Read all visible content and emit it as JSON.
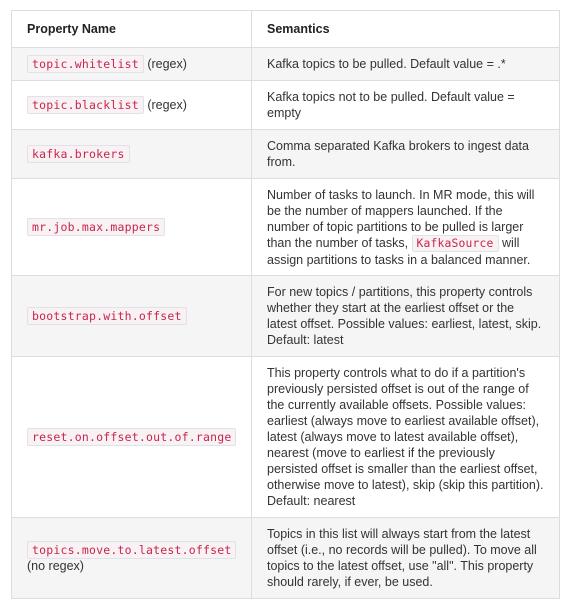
{
  "table": {
    "headers": [
      "Property Name",
      "Semantics"
    ],
    "rows": [
      {
        "property": "topic.whitelist",
        "property_suffix": " (regex)",
        "property_note": "",
        "semantics": "Kafka topics to be pulled. Default value = .*",
        "semantics_code": "",
        "semantics_after": ""
      },
      {
        "property": "topic.blacklist",
        "property_suffix": " (regex)",
        "property_note": "",
        "semantics": "Kafka topics not to be pulled. Default value = empty",
        "semantics_code": "",
        "semantics_after": ""
      },
      {
        "property": "kafka.brokers",
        "property_suffix": "",
        "property_note": "",
        "semantics": "Comma separated Kafka brokers to ingest data from.",
        "semantics_code": "",
        "semantics_after": ""
      },
      {
        "property": "mr.job.max.mappers",
        "property_suffix": "",
        "property_note": "",
        "semantics": "Number of tasks to launch. In MR mode, this will be the number of mappers launched. If the number of topic partitions to be pulled is larger than the number of tasks, ",
        "semantics_code": "KafkaSource",
        "semantics_after": " will assign partitions to tasks in a balanced manner."
      },
      {
        "property": "bootstrap.with.offset",
        "property_suffix": "",
        "property_note": "",
        "semantics": "For new topics / partitions, this property controls whether they start at the earliest offset or the latest offset. Possible values: earliest, latest, skip. Default: latest",
        "semantics_code": "",
        "semantics_after": ""
      },
      {
        "property": "reset.on.offset.out.of.range",
        "property_suffix": "",
        "property_note": "",
        "semantics": "This property controls what to do if a partition's previously persisted offset is out of the range of the currently available offsets. Possible values: earliest (always move to earliest available offset), latest (always move to latest available offset), nearest (move to earliest if the previously persisted offset is smaller than the earliest offset, otherwise move to latest), skip (skip this partition). Default: nearest",
        "semantics_code": "",
        "semantics_after": ""
      },
      {
        "property": "topics.move.to.latest.offset",
        "property_suffix": "",
        "property_note": "(no regex)",
        "semantics": "Topics in this list will always start from the latest offset (i.e., no records will be pulled). To move all topics to the latest offset, use \"all\". This property should rarely, if ever, be used.",
        "semantics_code": "",
        "semantics_after": ""
      }
    ]
  },
  "colors": {
    "code_text": "#c7254e",
    "code_bg": "#f9f2f4",
    "row_alt": "#f5f5f5",
    "border": "#dddddd"
  }
}
